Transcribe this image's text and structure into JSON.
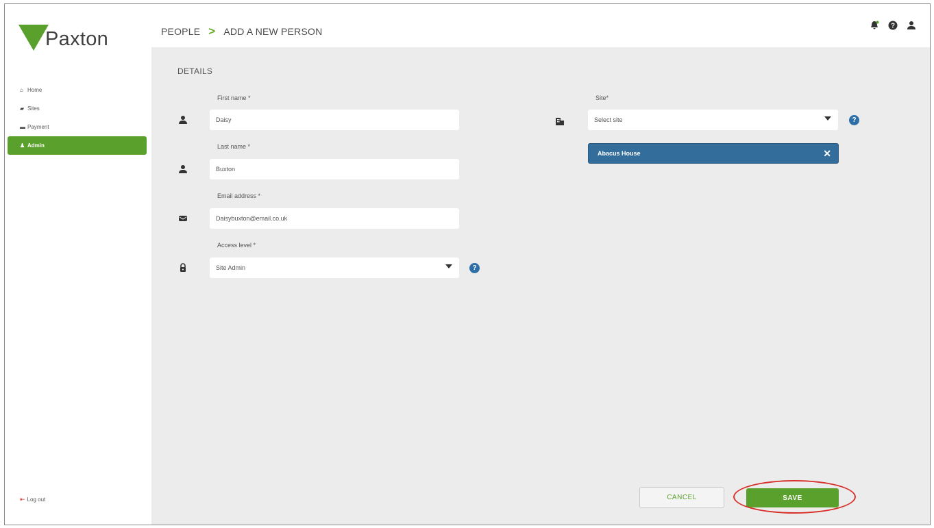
{
  "app": {
    "logo_text": "Paxton",
    "brand_green": "#5aa02c",
    "accent_blue": "#2e6fa8"
  },
  "sidebar": {
    "items": [
      {
        "label": "Home",
        "icon": "home-icon"
      },
      {
        "label": "Sites",
        "icon": "folder-icon"
      },
      {
        "label": "Payment",
        "icon": "card-icon"
      },
      {
        "label": "Admin",
        "icon": "person-icon",
        "active": true
      }
    ],
    "logout_label": "Log out"
  },
  "header": {
    "breadcrumb": {
      "parent": "PEOPLE",
      "separator": ">",
      "current": "ADD A NEW PERSON"
    },
    "icons": [
      "notification-icon",
      "help-icon",
      "user-icon"
    ]
  },
  "form": {
    "section_title": "DETAILS",
    "first_name": {
      "label": "First name *",
      "value": "Daisy"
    },
    "last_name": {
      "label": "Last name *",
      "value": "Buxton"
    },
    "email": {
      "label": "Email address *",
      "value": "Daisybuxton@email.co.uk"
    },
    "access_level": {
      "label": "Access level *",
      "value": "Site Admin"
    },
    "site": {
      "label": "Site*",
      "placeholder": "Select site",
      "selected_tag": "Abacus House"
    }
  },
  "actions": {
    "cancel_label": "CANCEL",
    "save_label": "SAVE"
  },
  "annotation": {
    "highlight_color": "#d8302a"
  }
}
